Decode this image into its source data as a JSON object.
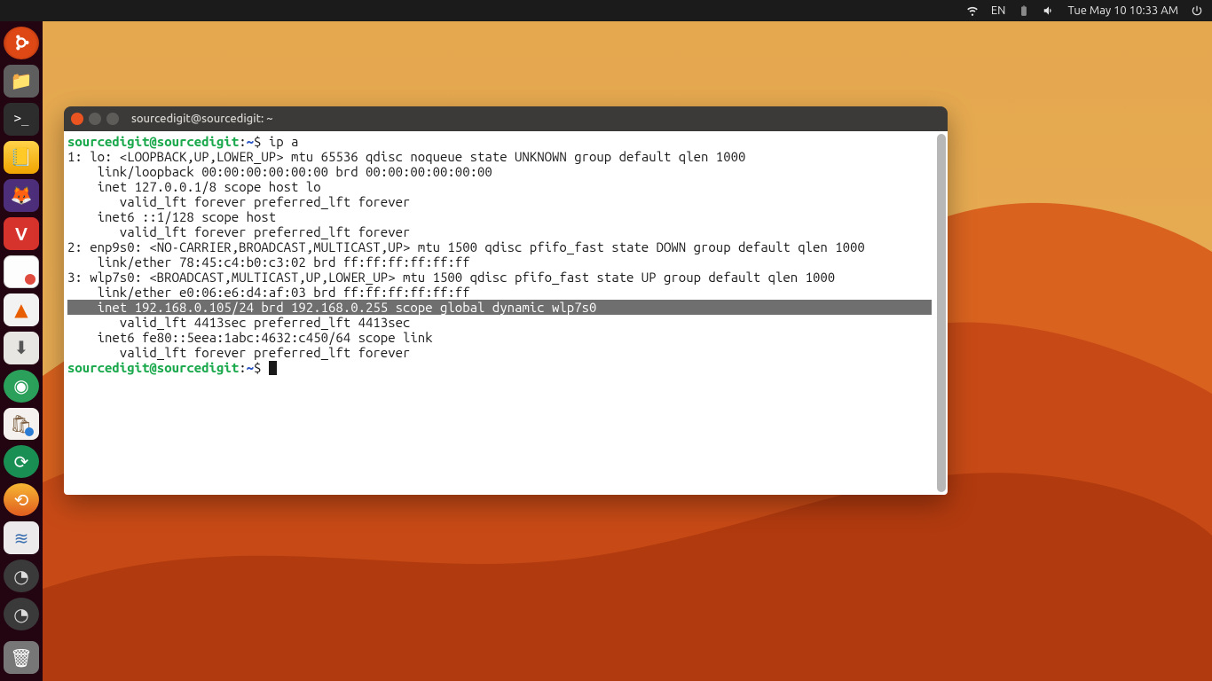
{
  "topbar": {
    "lang": "EN",
    "datetime": "Tue May 10 10:33 AM"
  },
  "launcher": {
    "items": [
      {
        "name": "ubuntu-dash",
        "glyph": ""
      },
      {
        "name": "files",
        "glyph": "📁"
      },
      {
        "name": "terminal",
        "glyph": ">_"
      },
      {
        "name": "notes-yellow",
        "glyph": "📒"
      },
      {
        "name": "firefox",
        "glyph": "🦊"
      },
      {
        "name": "vivaldi",
        "glyph": "V"
      },
      {
        "name": "text-editor",
        "glyph": ""
      },
      {
        "name": "vlc",
        "glyph": "▲"
      },
      {
        "name": "archive",
        "glyph": "⬇"
      },
      {
        "name": "shutter",
        "glyph": "◉"
      },
      {
        "name": "software-bag",
        "glyph": "🛍"
      },
      {
        "name": "updater",
        "glyph": "⟳"
      },
      {
        "name": "sync",
        "glyph": "⟲"
      },
      {
        "name": "software-center",
        "glyph": "≋"
      },
      {
        "name": "settings-1",
        "glyph": "◔"
      },
      {
        "name": "settings-2",
        "glyph": "◔"
      }
    ],
    "trash": {
      "name": "trash",
      "glyph": "🗑"
    }
  },
  "terminal": {
    "title": "sourcedigit@sourcedigit: ~",
    "prompt": {
      "user": "sourcedigit@sourcedigit",
      "sep": ":",
      "path": "~",
      "end": "$ "
    },
    "command": "ip a",
    "lines": [
      "1: lo: <LOOPBACK,UP,LOWER_UP> mtu 65536 qdisc noqueue state UNKNOWN group default qlen 1000",
      "    link/loopback 00:00:00:00:00:00 brd 00:00:00:00:00:00",
      "    inet 127.0.0.1/8 scope host lo",
      "       valid_lft forever preferred_lft forever",
      "    inet6 ::1/128 scope host",
      "       valid_lft forever preferred_lft forever",
      "2: enp9s0: <NO-CARRIER,BROADCAST,MULTICAST,UP> mtu 1500 qdisc pfifo_fast state DOWN group default qlen 1000",
      "    link/ether 78:45:c4:b0:c3:02 brd ff:ff:ff:ff:ff:ff",
      "3: wlp7s0: <BROADCAST,MULTICAST,UP,LOWER_UP> mtu 1500 qdisc pfifo_fast state UP group default qlen 1000",
      "    link/ether e0:06:e6:d4:af:03 brd ff:ff:ff:ff:ff:ff"
    ],
    "highlighted": "    inet 192.168.0.105/24 brd 192.168.0.255 scope global dynamic wlp7s0",
    "lines_after": [
      "       valid_lft 4413sec preferred_lft 4413sec",
      "    inet6 fe80::5eea:1abc:4632:c450/64 scope link",
      "       valid_lft forever preferred_lft forever"
    ]
  }
}
